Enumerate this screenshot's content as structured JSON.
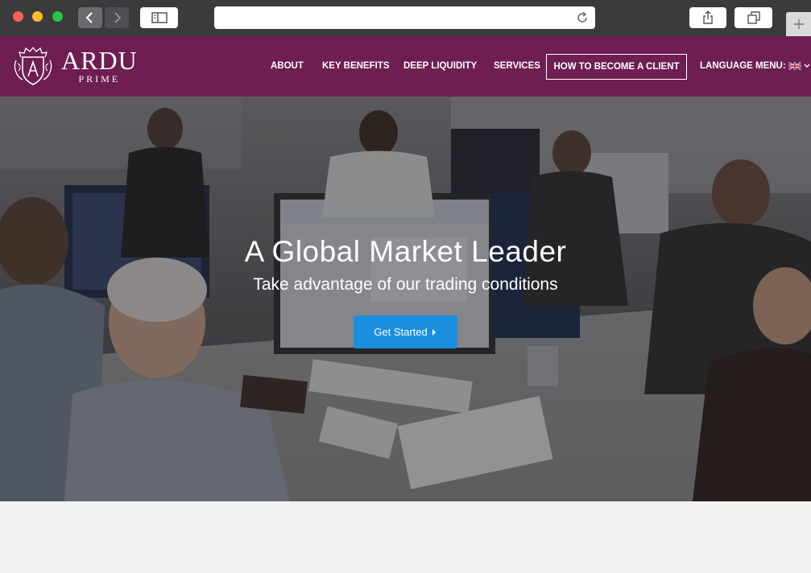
{
  "browser": {
    "address": ""
  },
  "brand": {
    "name": "ARDU",
    "subname": "PRIME"
  },
  "nav": {
    "items": [
      "ABOUT",
      "KEY BENEFITS",
      "DEEP LIQUIDITY",
      "SERVICES"
    ],
    "client_button": "HOW TO BECOME A CLIENT",
    "language_label": "LANGUAGE MENU:"
  },
  "hero": {
    "title": "A Global Market Leader",
    "subtitle": "Take advantage of our trading conditions",
    "cta_label": "Get Started",
    "cta_color": "#1a8fe0"
  },
  "colors": {
    "header_bg": "#6e1e52",
    "chrome_bg": "#3a3b3d"
  }
}
